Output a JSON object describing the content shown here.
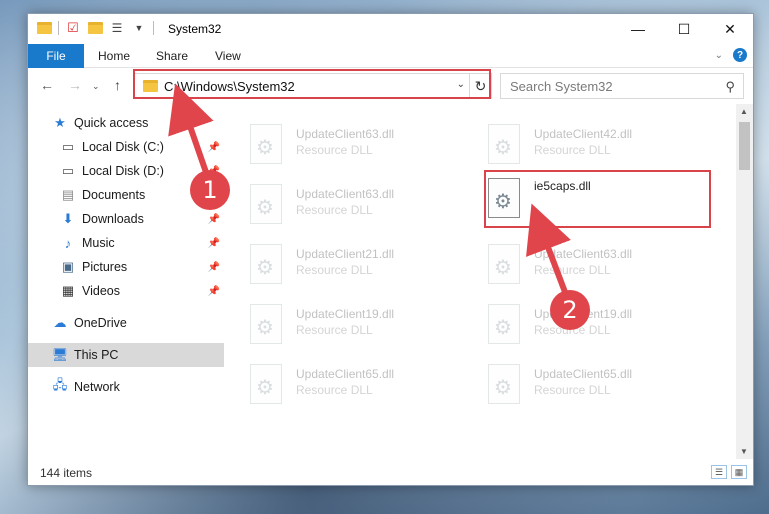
{
  "window": {
    "title": "System32",
    "tabs": {
      "file": "File",
      "home": "Home",
      "share": "Share",
      "view": "View"
    }
  },
  "address": {
    "path": "C:\\Windows\\System32",
    "search_placeholder": "Search System32"
  },
  "sidebar": {
    "items": [
      {
        "label": "Quick access",
        "icon": "star-icon"
      },
      {
        "label": "Local Disk (C:)",
        "icon": "drive-icon",
        "pinned": true
      },
      {
        "label": "Local Disk (D:)",
        "icon": "drive-icon",
        "pinned": true
      },
      {
        "label": "Documents",
        "icon": "documents-icon",
        "pinned": true
      },
      {
        "label": "Downloads",
        "icon": "download-icon",
        "pinned": true
      },
      {
        "label": "Music",
        "icon": "music-icon",
        "pinned": true
      },
      {
        "label": "Pictures",
        "icon": "pictures-icon",
        "pinned": true
      },
      {
        "label": "Videos",
        "icon": "videos-icon",
        "pinned": true
      },
      {
        "label": "OneDrive",
        "icon": "cloud-icon"
      },
      {
        "label": "This PC",
        "icon": "computer-icon",
        "selected": true
      },
      {
        "label": "Network",
        "icon": "network-icon"
      }
    ]
  },
  "files": [
    {
      "name": "UpdateClient63.dll",
      "type": "Resource DLL"
    },
    {
      "name": "UpdateClient42.dll",
      "type": "Resource DLL"
    },
    {
      "name": "UpdateClient63.dll",
      "type": "Resource DLL"
    },
    {
      "name": "ie5caps.dll",
      "type": "",
      "highlighted": true
    },
    {
      "name": "UpdateClient21.dll",
      "type": "Resource DLL"
    },
    {
      "name": "UpdateClient63.dll",
      "type": "Resource DLL"
    },
    {
      "name": "UpdateClient19.dll",
      "type": "Resource DLL"
    },
    {
      "name": "UpdateClient19.dll",
      "type": "Resource DLL"
    },
    {
      "name": "UpdateClient65.dll",
      "type": "Resource DLL"
    },
    {
      "name": "UpdateClient65.dll",
      "type": "Resource DLL"
    }
  ],
  "status": {
    "items_count": "144 items"
  },
  "annotations": {
    "badge1": "1",
    "badge2": "2",
    "color": "#e0454b"
  }
}
